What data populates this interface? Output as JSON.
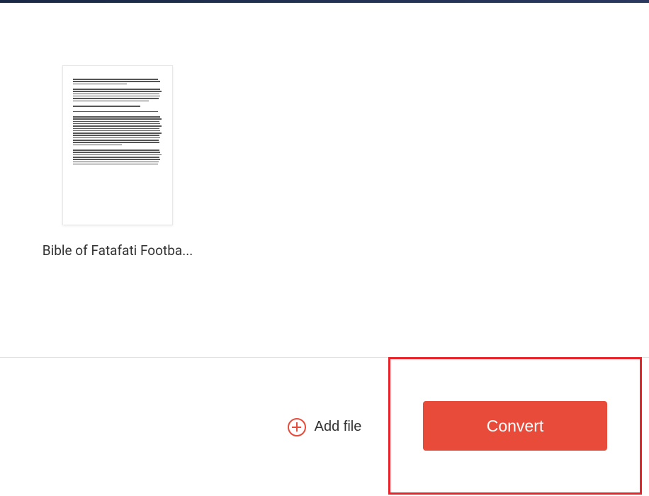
{
  "file": {
    "name": "Bible of Fatafati Footba..."
  },
  "actions": {
    "add_file_label": "Add file",
    "convert_label": "Convert"
  }
}
